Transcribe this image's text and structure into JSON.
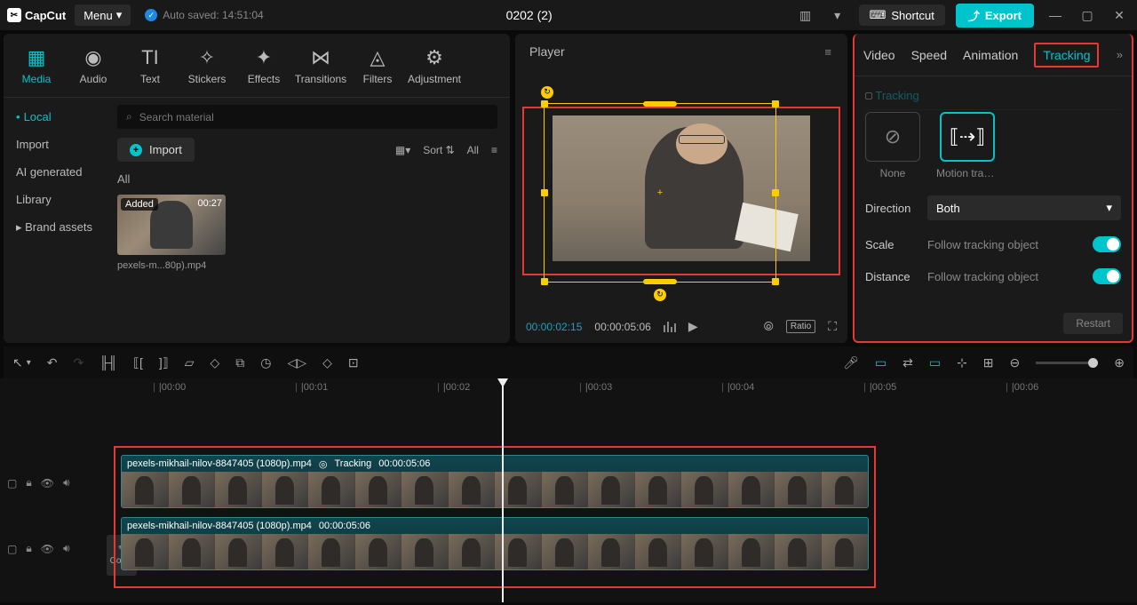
{
  "brand": "CapCut",
  "menu": "Menu",
  "autosave_label": "Auto saved: 14:51:04",
  "project_title": "0202 (2)",
  "shortcut_label": "Shortcut",
  "export_label": "Export",
  "tool_tabs": {
    "media": "Media",
    "audio": "Audio",
    "text": "Text",
    "stickers": "Stickers",
    "effects": "Effects",
    "transitions": "Transitions",
    "filters": "Filters",
    "adjustment": "Adjustment"
  },
  "sidebar": {
    "local": "Local",
    "import": "Import",
    "ai_generated": "AI generated",
    "library": "Library",
    "brand_assets": "Brand assets"
  },
  "search_placeholder": "Search material",
  "import_btn": "Import",
  "sort_label": "Sort",
  "all_btn": "All",
  "media_section": "All",
  "thumb": {
    "badge": "Added",
    "duration": "00:27",
    "name": "pexels-m...80p).mp4"
  },
  "player": {
    "title": "Player",
    "current": "00:00:02:15",
    "total": "00:00:05:06",
    "ratio": "Ratio"
  },
  "right_tabs": {
    "video": "Video",
    "speed": "Speed",
    "animation": "Animation",
    "tracking": "Tracking"
  },
  "tracking": {
    "heading": "Tracking",
    "none": "None",
    "motion": "Motion track...",
    "direction_label": "Direction",
    "direction_value": "Both",
    "scale_label": "Scale",
    "scale_sub": "Follow tracking object",
    "distance_label": "Distance",
    "distance_sub": "Follow tracking object",
    "restart": "Restart"
  },
  "ruler_seconds": [
    "|00:00",
    "|00:01",
    "|00:02",
    "|00:03",
    "|00:04",
    "|00:05",
    "|00:06"
  ],
  "clip1": {
    "name": "pexels-mikhail-nilov-8847405 (1080p).mp4",
    "tracking": "Tracking",
    "dur": "00:00:05:06"
  },
  "clip2": {
    "name": "pexels-mikhail-nilov-8847405 (1080p).mp4",
    "dur": "00:00:05:06"
  },
  "cover": "Cover"
}
